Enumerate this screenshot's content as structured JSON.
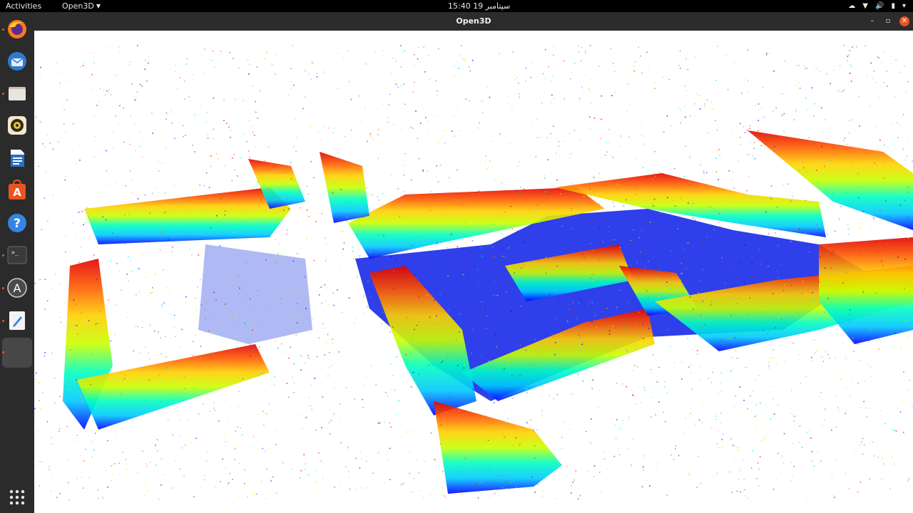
{
  "topbar": {
    "activities_label": "Activities",
    "app_menu_label": "Open3D",
    "clock": "15:40  19 سپتامبر"
  },
  "dock": {
    "items": [
      {
        "name": "firefox-icon",
        "running": true
      },
      {
        "name": "thunderbird-icon",
        "running": false
      },
      {
        "name": "files-icon",
        "running": true
      },
      {
        "name": "rhythmbox-icon",
        "running": false
      },
      {
        "name": "writer-icon",
        "running": false
      },
      {
        "name": "software-icon",
        "running": false
      },
      {
        "name": "help-icon",
        "running": false
      },
      {
        "name": "terminal-icon",
        "running": true
      },
      {
        "name": "updater-icon",
        "running": true
      },
      {
        "name": "text-editor-icon",
        "running": true
      },
      {
        "name": "open3d-window-icon",
        "running": true
      }
    ]
  },
  "window": {
    "title": "Open3D",
    "buttons": {
      "minimize": "–",
      "maximize": "▫",
      "close": "✕"
    }
  },
  "viewport": {
    "content": "point-cloud",
    "colormap": [
      "#0000ff",
      "#00c8ff",
      "#00ffc0",
      "#c8ff00",
      "#ffd000",
      "#ff5a00",
      "#e00000"
    ],
    "background": "#ffffff"
  }
}
